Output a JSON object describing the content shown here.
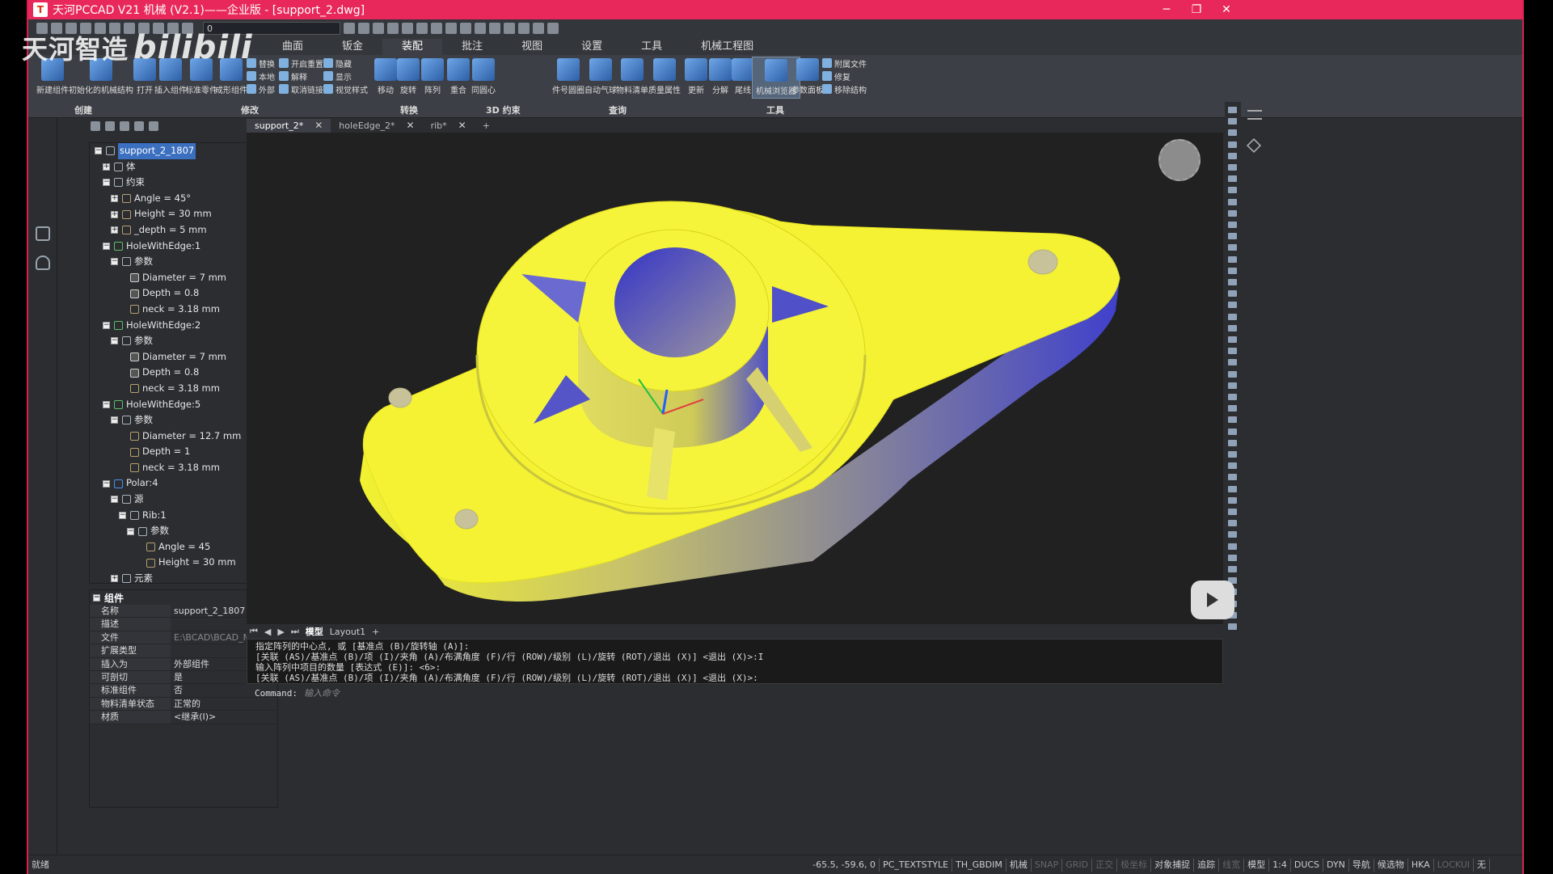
{
  "window": {
    "title": "天河PCCAD V21 机械 (V2.1)——企业版 - [support_2.dwg]",
    "minimize": "─",
    "restore": "❐",
    "close": "✕"
  },
  "quick_access": {
    "layer_value": "0"
  },
  "ribbon_tabs": [
    "曲面",
    "钣金",
    "装配",
    "批注",
    "视图",
    "设置",
    "工具",
    "机械工程图"
  ],
  "ribbon_active_tab": "装配",
  "ribbon": {
    "groups": [
      "创建",
      "修改",
      "转换",
      "3D 约束",
      "查询",
      "工具"
    ],
    "buttons": {
      "new_component": "新建组件",
      "init_struct": "初始化的机械结构",
      "open": "打开",
      "insert_component": "插入组件",
      "standard_part": "标准零件",
      "form_component": "成形组件",
      "replace": "替换",
      "local": "本地",
      "external": "外部",
      "open_reset": "开启重置",
      "unlock": "解释",
      "cancel_link": "取消链接",
      "hide": "隐藏",
      "show": "显示",
      "visual_style": "视觉样式",
      "move": "移动",
      "rotate": "旋转",
      "array": "阵列",
      "coincide": "重合",
      "concentric": "同圆心",
      "balloon": "件号圆圈",
      "auto_balloon": "自动气球",
      "bom": "物料清单",
      "mass_prop": "质量属性",
      "update": "更新",
      "explode": "分解",
      "tail": "尾线",
      "browser": "机械浏览器",
      "param_panel": "参数面板",
      "attach_file": "附属文件",
      "repair": "修复",
      "remove_struct": "移除结构"
    }
  },
  "doc_tabs": [
    {
      "label": "support_2*",
      "active": true
    },
    {
      "label": "holeEdge_2*",
      "active": false
    },
    {
      "label": "rib*",
      "active": false
    }
  ],
  "doc_tab_add": "+",
  "tree": [
    {
      "level": 0,
      "exp": "−",
      "icon": "component",
      "label": "support_2_1807",
      "root": true
    },
    {
      "level": 1,
      "exp": "+",
      "icon": "folder",
      "label": "体"
    },
    {
      "level": 1,
      "exp": "−",
      "icon": "folder",
      "label": "约束"
    },
    {
      "level": 2,
      "exp": "+",
      "icon": "constraint",
      "label": "Angle = 45°"
    },
    {
      "level": 2,
      "exp": "+",
      "icon": "constraint",
      "label": "Height = 30 mm"
    },
    {
      "level": 2,
      "exp": "+",
      "icon": "constraint",
      "label": "_depth = 5 mm"
    },
    {
      "level": 1,
      "exp": "−",
      "icon": "feature",
      "label": "HoleWithEdge:1"
    },
    {
      "level": 2,
      "exp": "−",
      "icon": "folder",
      "label": "参数"
    },
    {
      "level": 3,
      "exp": "",
      "icon": "lock",
      "label": "Diameter = 7 mm"
    },
    {
      "level": 3,
      "exp": "",
      "icon": "lock",
      "label": "Depth = 0.8"
    },
    {
      "level": 3,
      "exp": "",
      "icon": "param",
      "label": "neck = 3.18 mm"
    },
    {
      "level": 1,
      "exp": "−",
      "icon": "feature",
      "label": "HoleWithEdge:2"
    },
    {
      "level": 2,
      "exp": "−",
      "icon": "folder",
      "label": "参数"
    },
    {
      "level": 3,
      "exp": "",
      "icon": "lock",
      "label": "Diameter = 7 mm"
    },
    {
      "level": 3,
      "exp": "",
      "icon": "lock",
      "label": "Depth = 0.8"
    },
    {
      "level": 3,
      "exp": "",
      "icon": "param",
      "label": "neck = 3.18 mm"
    },
    {
      "level": 1,
      "exp": "−",
      "icon": "feature",
      "label": "HoleWithEdge:5"
    },
    {
      "level": 2,
      "exp": "−",
      "icon": "folder",
      "label": "参数"
    },
    {
      "level": 3,
      "exp": "",
      "icon": "param",
      "label": "Diameter = 12.7 mm"
    },
    {
      "level": 3,
      "exp": "",
      "icon": "param",
      "label": "Depth = 1"
    },
    {
      "level": 3,
      "exp": "",
      "icon": "param",
      "label": "neck = 3.18 mm"
    },
    {
      "level": 1,
      "exp": "−",
      "icon": "polar",
      "label": "Polar:4"
    },
    {
      "level": 2,
      "exp": "−",
      "icon": "folder",
      "label": "源"
    },
    {
      "level": 3,
      "exp": "−",
      "icon": "component",
      "label": "Rib:1"
    },
    {
      "level": 4,
      "exp": "−",
      "icon": "folder",
      "label": "参数"
    },
    {
      "level": 5,
      "exp": "",
      "icon": "param",
      "label": "Angle = 45"
    },
    {
      "level": 5,
      "exp": "",
      "icon": "param",
      "label": "Height = 30 mm"
    },
    {
      "level": 2,
      "exp": "+",
      "icon": "folder",
      "label": "元素"
    }
  ],
  "properties": {
    "header": "组件",
    "rows": [
      {
        "k": "名称",
        "v": "support_2_1807"
      },
      {
        "k": "描述",
        "v": ""
      },
      {
        "k": "文件",
        "v": "E:\\BCAD\\BCAD_Mech基础",
        "dim": true
      },
      {
        "k": "扩展类型",
        "v": ""
      },
      {
        "k": "插入为",
        "v": "外部组件"
      },
      {
        "k": "可剖切",
        "v": "是"
      },
      {
        "k": "标准组件",
        "v": "否"
      },
      {
        "k": "物料清单状态",
        "v": "正常的"
      },
      {
        "k": "材质",
        "v": "<继承(I)>"
      }
    ]
  },
  "layout_tabs": {
    "model": "模型",
    "layout1": "Layout1",
    "add": "+"
  },
  "command_history": [
    "指定阵列的中心点, 或 [基准点 (B)/旋转轴 (A)]:",
    "[关联 (AS)/基准点 (B)/项 (I)/夹角 (A)/布满角度 (F)/行 (ROW)/级别 (L)/旋转 (ROT)/退出 (X)] <退出 (X)>:I",
    "输入阵列中项目的数量 [表达式 (E)]: <6>:",
    "[关联 (AS)/基准点 (B)/项 (I)/夹角 (A)/布满角度 (F)/行 (ROW)/级别 (L)/旋转 (ROT)/退出 (X)] <退出 (X)>:"
  ],
  "command": {
    "label": "Command:",
    "placeholder": "输入命令"
  },
  "status": {
    "left": "就绪",
    "coords": "-65.5, -59.6, 0",
    "items": [
      {
        "t": "PC_TEXTSTYLE",
        "off": false
      },
      {
        "t": "TH_GBDIM",
        "off": false
      },
      {
        "t": "机械",
        "off": false
      },
      {
        "t": "SNAP",
        "off": true
      },
      {
        "t": "GRID",
        "off": true
      },
      {
        "t": "正交",
        "off": true
      },
      {
        "t": "极坐标",
        "off": true
      },
      {
        "t": "对象捕捉",
        "off": false
      },
      {
        "t": "追踪",
        "off": false
      },
      {
        "t": "线宽",
        "off": true
      },
      {
        "t": "模型",
        "off": false
      },
      {
        "t": "1:4",
        "off": false
      },
      {
        "t": "DUCS",
        "off": false
      },
      {
        "t": "DYN",
        "off": false
      },
      {
        "t": "导航",
        "off": false
      },
      {
        "t": "候选物",
        "off": false
      },
      {
        "t": "HKA",
        "off": false
      },
      {
        "t": "LOCKUI",
        "off": true
      },
      {
        "t": "无",
        "off": false
      }
    ]
  },
  "watermark": {
    "text": "天河智造",
    "brand": "bilibili"
  },
  "colors": {
    "accent": "#e8285a",
    "part_face": "#f2f230",
    "part_shade": "#4b4bd0",
    "viewport_bg": "#212121"
  }
}
